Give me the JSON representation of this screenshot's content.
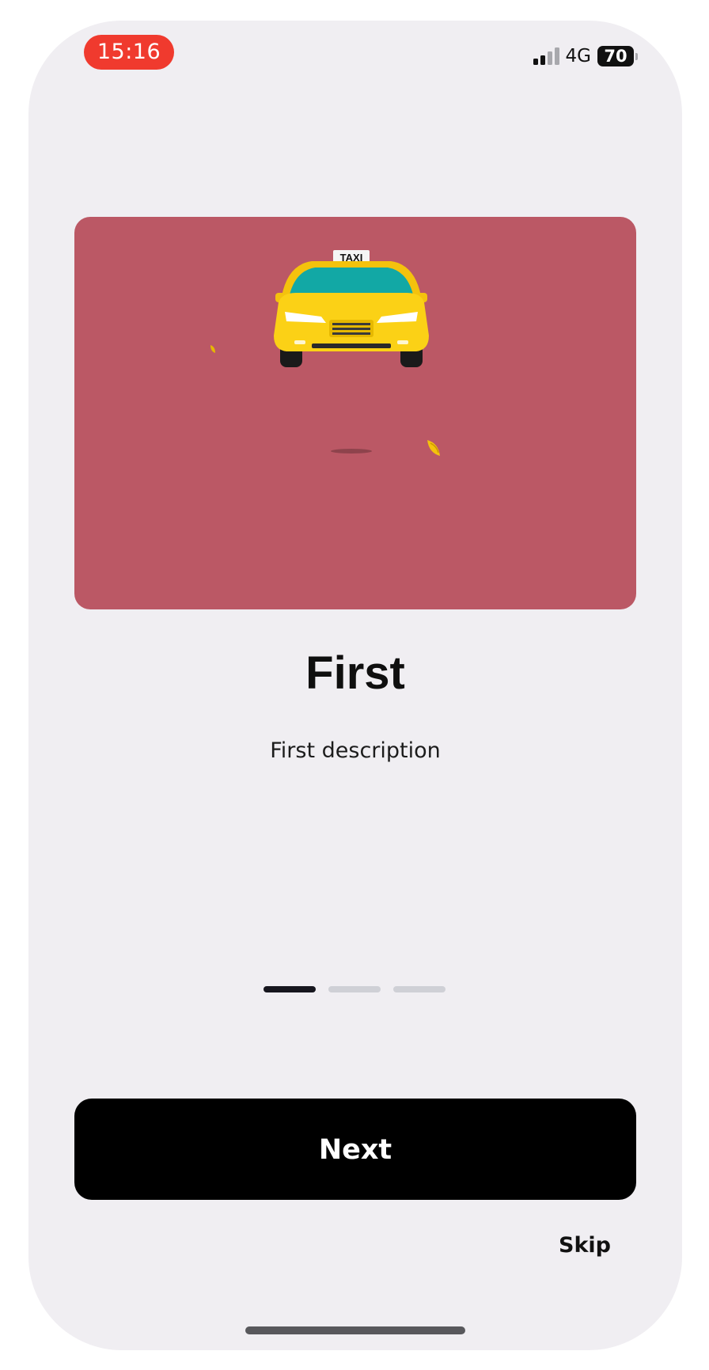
{
  "status_bar": {
    "time": "15:16",
    "network": "4G",
    "battery": "70"
  },
  "hero": {
    "illustration": "taxi-car",
    "sign_text": "TAXI",
    "background_color": "#bb5865"
  },
  "content": {
    "title": "First",
    "description": "First description"
  },
  "pager": {
    "pages": 3,
    "active_index": 0
  },
  "actions": {
    "next_label": "Next",
    "skip_label": "Skip"
  }
}
